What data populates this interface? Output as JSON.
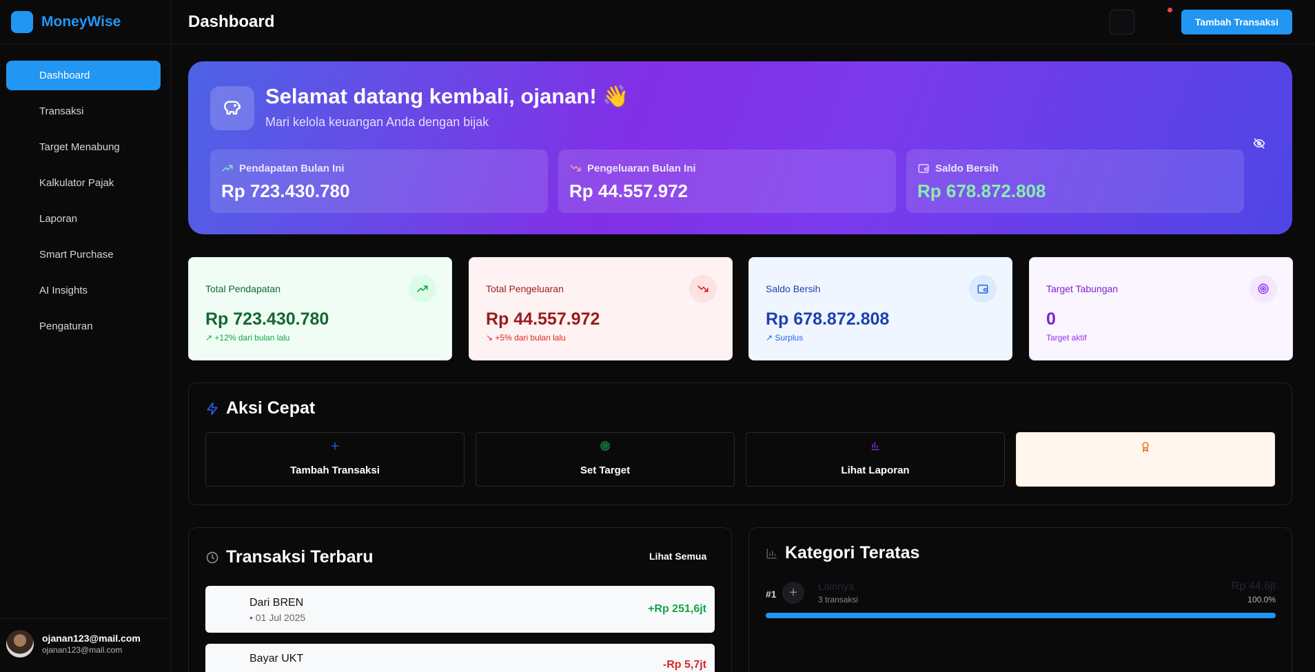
{
  "app": {
    "name": "MoneyWise"
  },
  "sidebar": {
    "items": [
      {
        "label": "Dashboard",
        "active": true
      },
      {
        "label": "Transaksi"
      },
      {
        "label": "Target Menabung"
      },
      {
        "label": "Kalkulator Pajak"
      },
      {
        "label": "Laporan"
      },
      {
        "label": "Smart Purchase"
      },
      {
        "label": "AI Insights"
      },
      {
        "label": "Pengaturan"
      }
    ],
    "user": {
      "name": "ojanan123@mail.com",
      "email": "ojanan123@mail.com"
    }
  },
  "header": {
    "title": "Dashboard",
    "add_button_label": "Tambah Transaksi"
  },
  "hero": {
    "title": "Selamat datang kembali, ojanan! 👋",
    "subtitle": "Mari kelola keuangan Anda dengan bijak",
    "stats": [
      {
        "label": "Pendapatan Bulan Ini",
        "value": "Rp 723.430.780",
        "icon": "trending-up-icon"
      },
      {
        "label": "Pengeluaran Bulan Ini",
        "value": "Rp 44.557.972",
        "icon": "trending-down-icon"
      },
      {
        "label": "Saldo Bersih",
        "value": "Rp 678.872.808",
        "icon": "wallet-icon"
      }
    ]
  },
  "cards": [
    {
      "label": "Total Pendapatan",
      "value": "Rp 723.430.780",
      "sub": "↗ +12% dari bulan lalu",
      "icon": "trending-up-icon",
      "color": "#166534",
      "bg": "#effdf4"
    },
    {
      "label": "Total Pengeluaran",
      "value": "Rp 44.557.972",
      "sub": "↘ +5% dari bulan lalu",
      "icon": "trending-down-icon",
      "color": "#991b1b",
      "bg": "#fef2f2"
    },
    {
      "label": "Saldo Bersih",
      "value": "Rp 678.872.808",
      "sub": "↗ Surplus",
      "icon": "wallet-icon",
      "color": "#1e40af",
      "bg": "#eff6ff"
    },
    {
      "label": "Target Tabungan",
      "value": "0",
      "sub": "Target aktif",
      "icon": "target-icon",
      "color": "#7e22ce",
      "bg": "#faf5ff"
    }
  ],
  "quick_actions": {
    "title": "Aksi Cepat",
    "items": [
      {
        "label": "Tambah Transaksi",
        "icon": "plus-icon",
        "color": "#2563eb"
      },
      {
        "label": "Set Target",
        "icon": "target-icon",
        "color": "#16a34a"
      },
      {
        "label": "Lihat Laporan",
        "icon": "bar-chart-icon",
        "color": "#9333ea"
      },
      {
        "label": "",
        "icon": "award-icon",
        "color": "#ea580c"
      }
    ]
  },
  "recent": {
    "title": "Transaksi Terbaru",
    "see_all": "Lihat Semua",
    "rows": [
      {
        "title": "Dari BREN",
        "date": "• 01 Jul 2025",
        "amount": "+Rp 251,6jt",
        "color": "#16a34a"
      },
      {
        "title": "Bayar UKT",
        "date": "",
        "amount": "-Rp 5,7jt",
        "color": "#dc2626"
      }
    ]
  },
  "categories": {
    "title": "Kategori Teratas",
    "items": [
      {
        "rank": "#1",
        "name": "Lainnya",
        "count": "3 transaksi",
        "amount": "Rp 44,6jt",
        "percent": "100.0%",
        "fraction": 1.0
      }
    ]
  }
}
